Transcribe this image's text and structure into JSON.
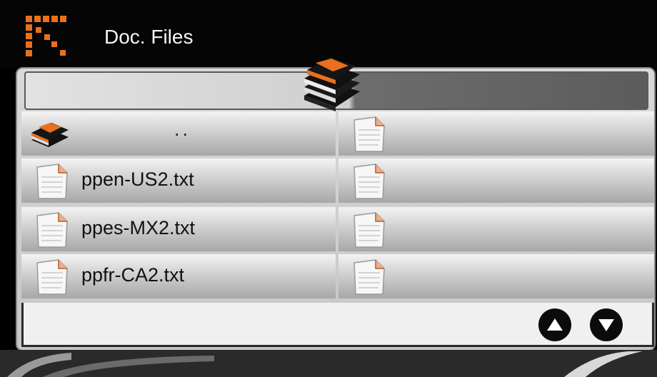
{
  "header": {
    "title": "Doc. Files"
  },
  "path": {
    "value": ""
  },
  "files": [
    {
      "name": "..",
      "type": "parent-folder"
    },
    {
      "name": "ppen-US2.txt",
      "type": "text-file"
    },
    {
      "name": "ppes-MX2.txt",
      "type": "text-file"
    },
    {
      "name": "ppfr-CA2.txt",
      "type": "text-file"
    },
    {
      "name": "",
      "type": "text-file"
    },
    {
      "name": "",
      "type": "text-file"
    },
    {
      "name": "",
      "type": "text-file"
    },
    {
      "name": "",
      "type": "text-file"
    }
  ],
  "icons": {
    "logo": "corner-logo-icon",
    "folder": "folder-stack-icon",
    "file": "document-icon",
    "up": "arrow-up-icon",
    "down": "arrow-down-icon"
  },
  "colors": {
    "accent": "#e8701e",
    "background": "#000000",
    "panel": "#d0d0d0"
  }
}
